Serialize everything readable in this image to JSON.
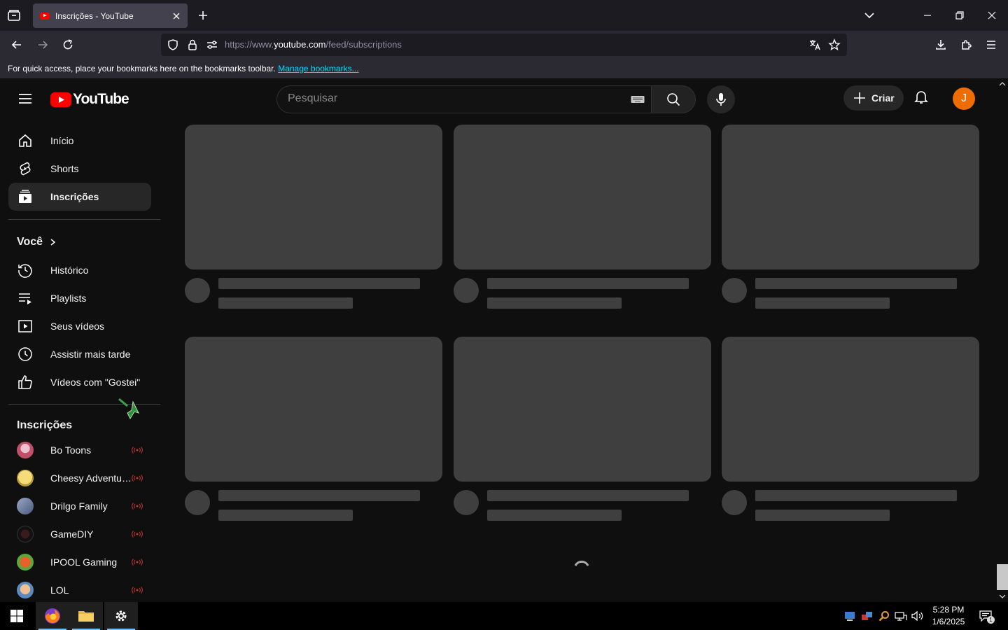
{
  "browser": {
    "tab_title": "Inscrições - YouTube",
    "url_prefix": "https://www.",
    "url_host": "youtube.com",
    "url_path": "/feed/subscriptions",
    "bookmarks_text": "For quick access, place your bookmarks here on the bookmarks toolbar.",
    "bookmarks_link": "Manage bookmarks..."
  },
  "youtube": {
    "logo_text": "YouTube",
    "search_placeholder": "Pesquisar",
    "create_label": "Criar",
    "avatar_letter": "J",
    "nav": [
      {
        "label": "Início",
        "icon": "home-icon"
      },
      {
        "label": "Shorts",
        "icon": "shorts-icon"
      },
      {
        "label": "Inscrições",
        "icon": "subscriptions-icon",
        "active": true
      }
    ],
    "you_section": {
      "title": "Você",
      "items": [
        {
          "label": "Histórico",
          "icon": "history-icon"
        },
        {
          "label": "Playlists",
          "icon": "playlists-icon"
        },
        {
          "label": "Seus vídeos",
          "icon": "your-videos-icon"
        },
        {
          "label": "Assistir mais tarde",
          "icon": "watch-later-icon"
        },
        {
          "label": "Vídeos com \"Gostei\"",
          "icon": "liked-icon"
        }
      ]
    },
    "subscriptions": {
      "title": "Inscrições",
      "channels": [
        {
          "name": "Bo Toons",
          "color": "#c0506a"
        },
        {
          "name": "Cheesy Adventures",
          "color": "#d9c26a"
        },
        {
          "name": "Drilgo Family",
          "color": "#6a7a9a"
        },
        {
          "name": "GameDIY",
          "color": "#1a1a1a"
        },
        {
          "name": "IPOOL Gaming",
          "color": "#d35a2a"
        },
        {
          "name": "LOL",
          "color": "#5a8ac0"
        }
      ]
    }
  },
  "taskbar": {
    "time": "5:28 PM",
    "date": "1/6/2025",
    "notification_count": "1"
  },
  "colors": {
    "yt_red": "#ff0000",
    "live_red": "#ff4e45",
    "skeleton": "#3f3f3f",
    "avatar": "#ef6c00"
  }
}
